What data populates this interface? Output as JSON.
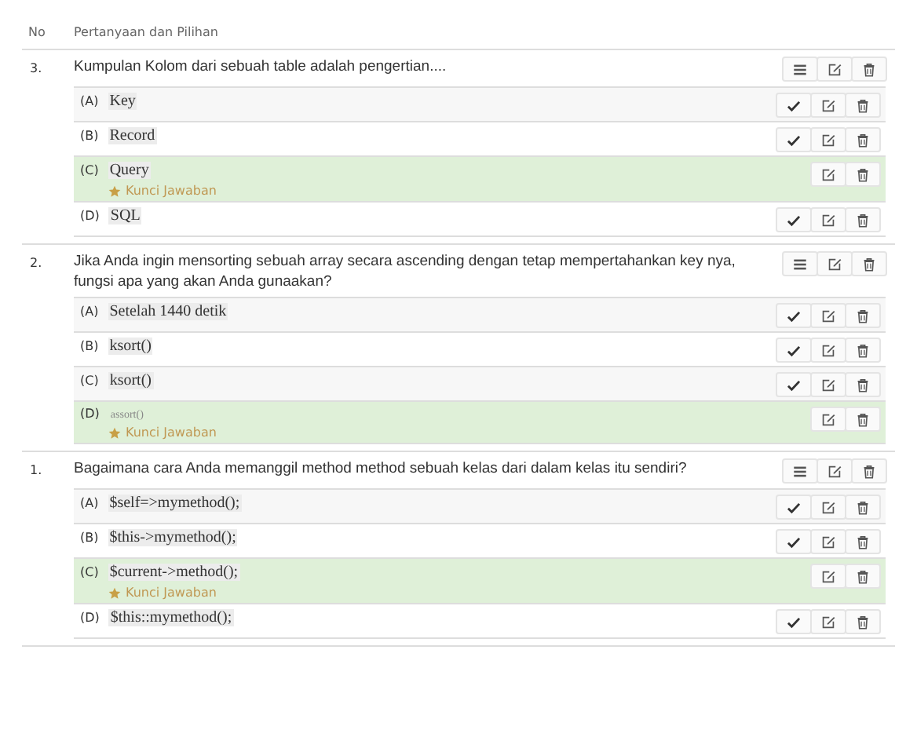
{
  "table": {
    "columns": [
      "No",
      "Pertanyaan dan Pilihan"
    ]
  },
  "questions": [
    {
      "number": "3.",
      "text": "Kumpulan Kolom dari sebuah table adalah pengertian....",
      "options": [
        {
          "letter": "(A)",
          "text": "Key",
          "is_key": false,
          "faint": false
        },
        {
          "letter": "(B)",
          "text": "Record",
          "is_key": false,
          "faint": false
        },
        {
          "letter": "(C)",
          "text": "Query",
          "is_key": true,
          "faint": false,
          "key_label": "Kunci Jawaban"
        },
        {
          "letter": "(D)",
          "text": "SQL",
          "is_key": false,
          "faint": false
        }
      ]
    },
    {
      "number": "2.",
      "text": "Jika Anda ingin mensorting sebuah array secara ascending dengan tetap mempertahankan key nya, fungsi apa yang akan Anda gunaakan?",
      "options": [
        {
          "letter": "(A)",
          "text": "Setelah 1440 detik",
          "is_key": false,
          "faint": false
        },
        {
          "letter": "(B)",
          "text": "ksort()",
          "is_key": false,
          "faint": false
        },
        {
          "letter": "(C)",
          "text": "ksort()",
          "is_key": false,
          "faint": false
        },
        {
          "letter": "(D)",
          "text": "assort()",
          "is_key": true,
          "faint": true,
          "key_label": "Kunci Jawaban"
        }
      ]
    },
    {
      "number": "1.",
      "text": "Bagaimana cara Anda memanggil method method sebuah kelas dari dalam kelas itu sendiri?",
      "options": [
        {
          "letter": "(A)",
          "text": "$self=>mymethod();",
          "is_key": false,
          "faint": false
        },
        {
          "letter": "(B)",
          "text": "$this->mymethod();",
          "is_key": false,
          "faint": false
        },
        {
          "letter": "(C)",
          "text": "$current->method();",
          "is_key": true,
          "faint": false,
          "key_label": "Kunci Jawaban"
        },
        {
          "letter": "(D)",
          "text": "$this::mymethod();",
          "is_key": false,
          "faint": false
        }
      ]
    }
  ]
}
